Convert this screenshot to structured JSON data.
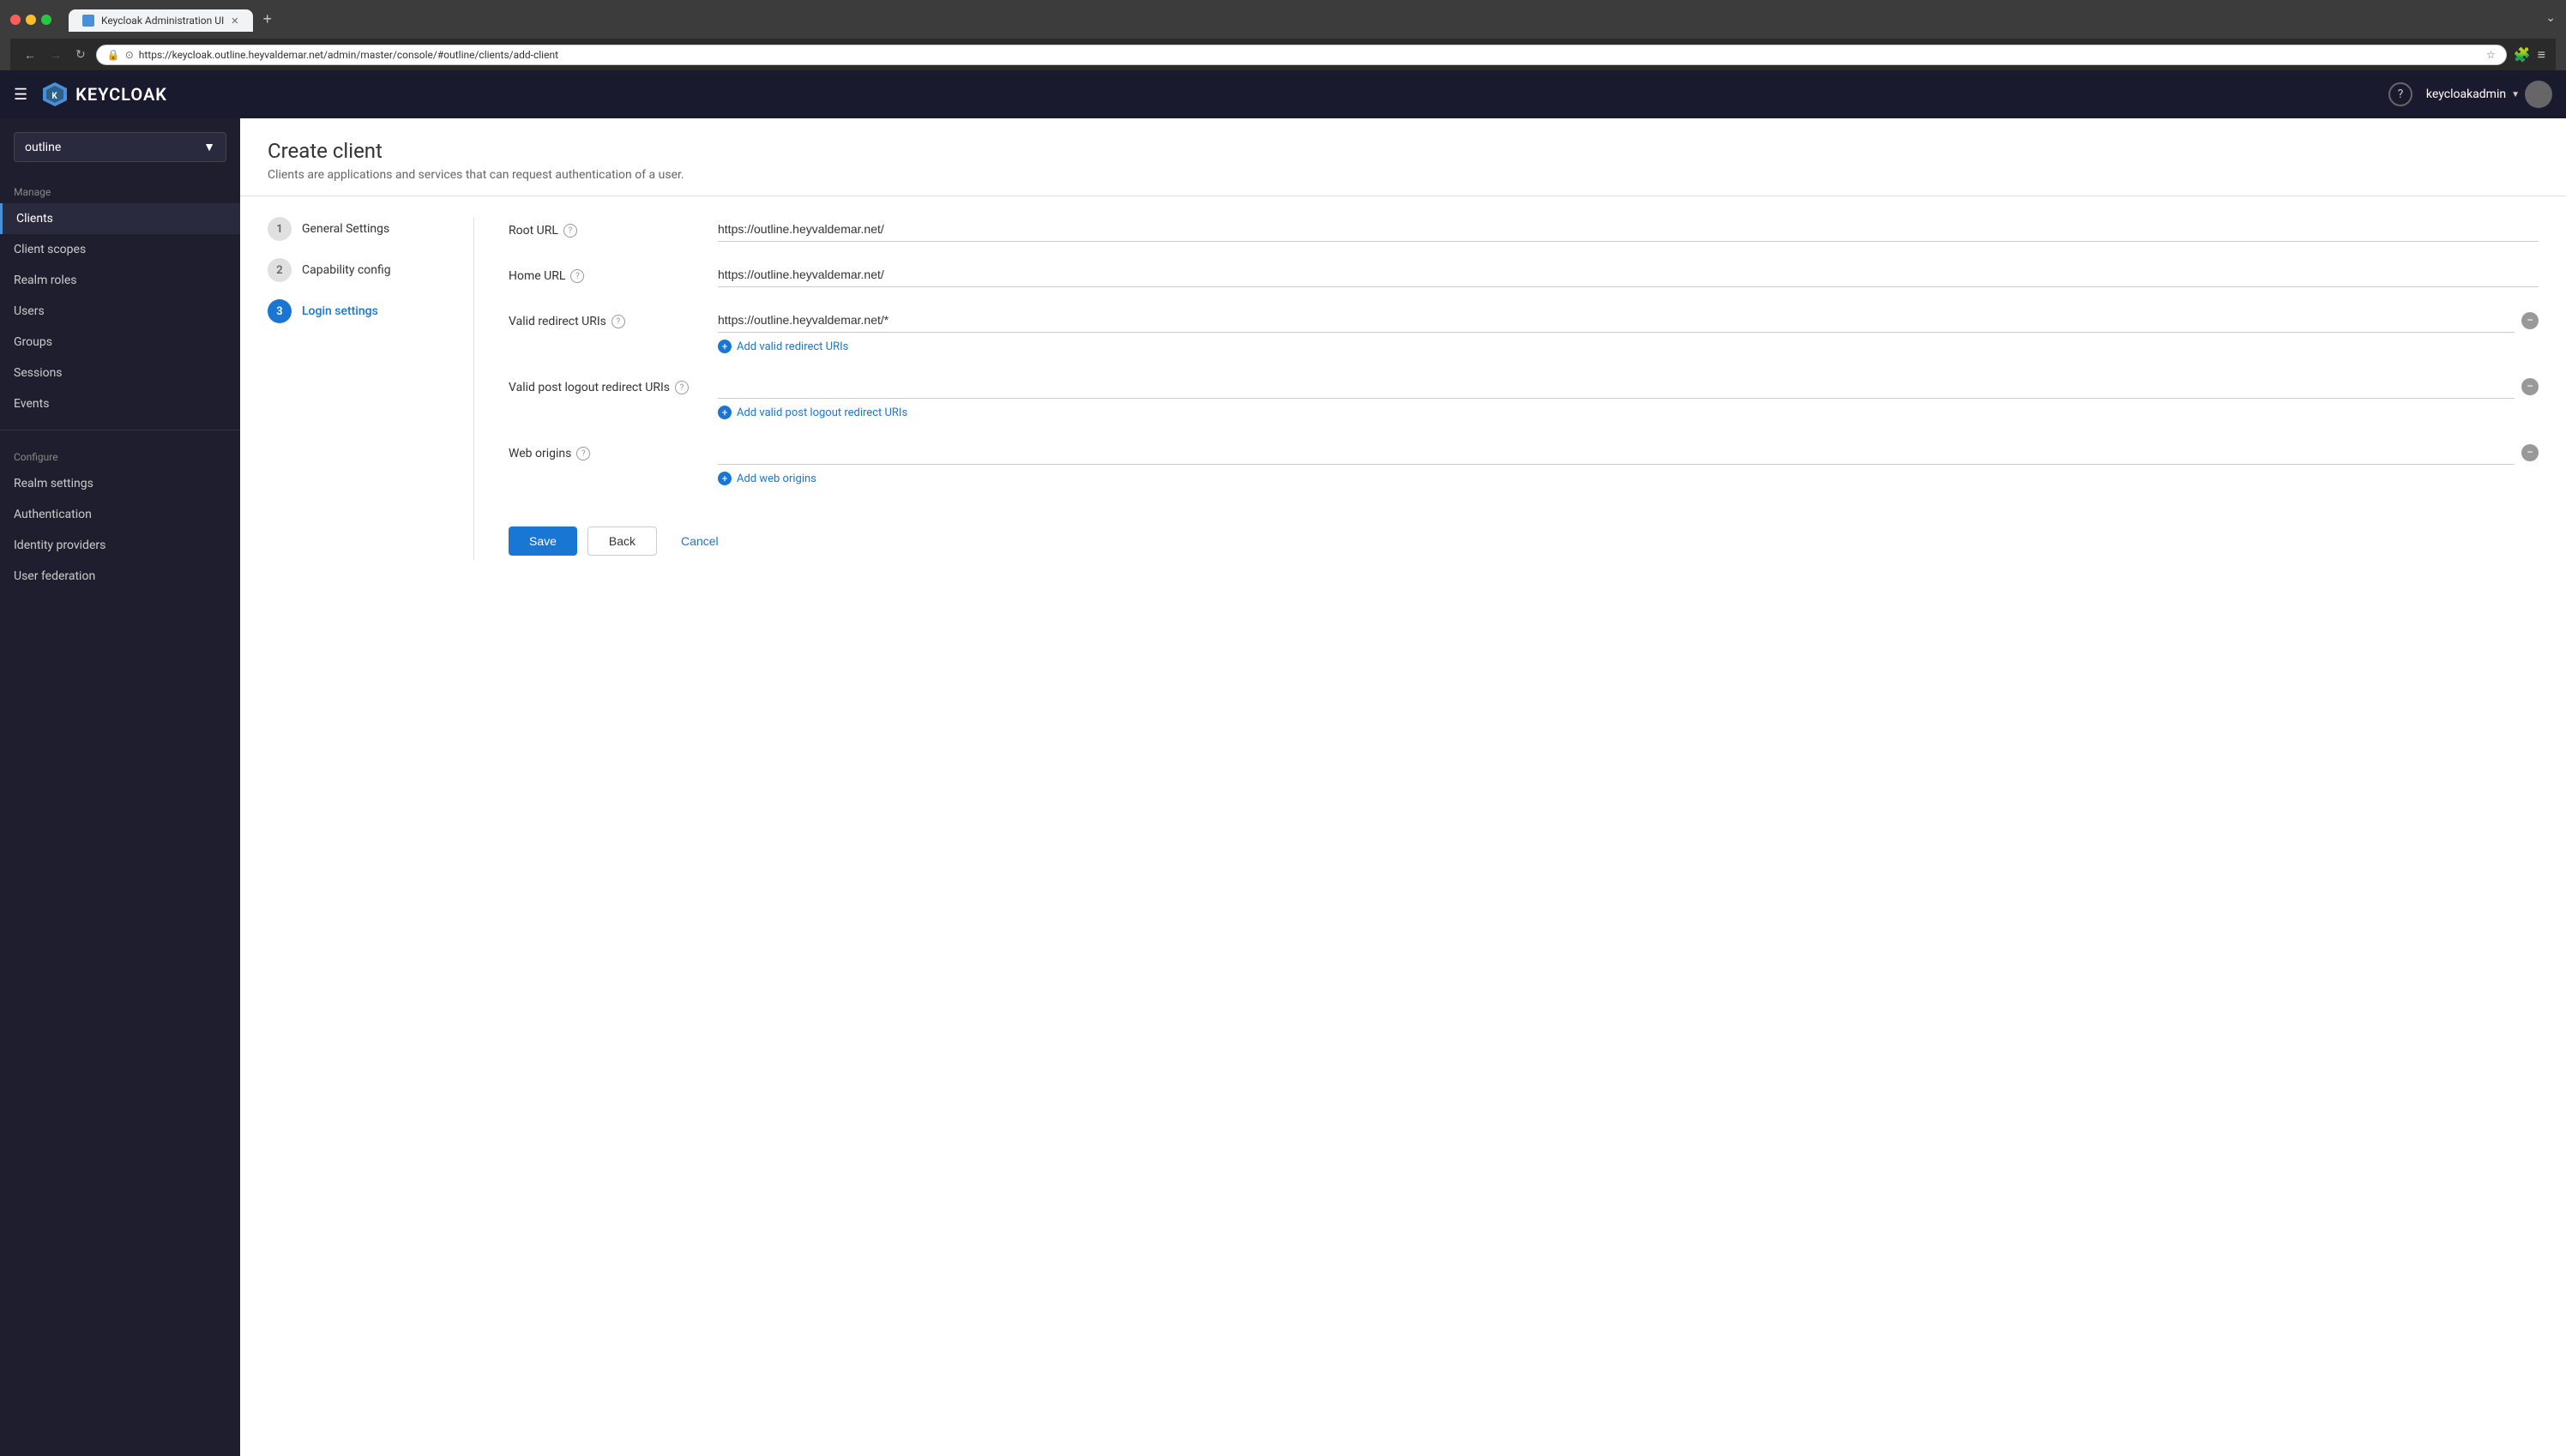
{
  "browser": {
    "url": "https://keycloak.outline.heyvaldemar.net/admin/master/console/#outline/clients/add-client",
    "tab_title": "Keycloak Administration UI",
    "new_tab_label": "+"
  },
  "topnav": {
    "logo_text": "KEYCLOAK",
    "user_name": "keycloakadmin",
    "help_label": "?"
  },
  "sidebar": {
    "realm_name": "outline",
    "manage_header": "Manage",
    "configure_header": "Configure",
    "items_manage": [
      {
        "label": "Clients",
        "active": true
      },
      {
        "label": "Client scopes",
        "active": false
      },
      {
        "label": "Realm roles",
        "active": false
      },
      {
        "label": "Users",
        "active": false
      },
      {
        "label": "Groups",
        "active": false
      },
      {
        "label": "Sessions",
        "active": false
      },
      {
        "label": "Events",
        "active": false
      }
    ],
    "items_configure": [
      {
        "label": "Realm settings",
        "active": false
      },
      {
        "label": "Authentication",
        "active": false
      },
      {
        "label": "Identity providers",
        "active": false
      },
      {
        "label": "User federation",
        "active": false
      }
    ]
  },
  "page": {
    "title": "Create client",
    "subtitle": "Clients are applications and services that can request authentication of a user."
  },
  "wizard": {
    "steps": [
      {
        "number": "1",
        "label": "General Settings",
        "state": "inactive"
      },
      {
        "number": "2",
        "label": "Capability config",
        "state": "inactive"
      },
      {
        "number": "3",
        "label": "Login settings",
        "state": "active"
      }
    ]
  },
  "form": {
    "fields": [
      {
        "id": "root_url",
        "label": "Root URL",
        "has_help": true,
        "value": "https://outline.heyvaldemar.net/",
        "type": "text"
      },
      {
        "id": "home_url",
        "label": "Home URL",
        "has_help": true,
        "value": "https://outline.heyvaldemar.net/",
        "type": "text"
      },
      {
        "id": "valid_redirect_uris",
        "label": "Valid redirect URIs",
        "has_help": true,
        "value": "https://outline.heyvaldemar.net/*",
        "type": "input_with_remove",
        "add_link_text": "Add valid redirect URIs"
      },
      {
        "id": "valid_post_logout",
        "label": "Valid post logout redirect URIs",
        "has_help": true,
        "value": "",
        "type": "input_with_remove",
        "add_link_text": "Add valid post logout redirect URIs"
      },
      {
        "id": "web_origins",
        "label": "Web origins",
        "has_help": true,
        "value": "",
        "type": "input_with_remove",
        "add_link_text": "Add web origins"
      }
    ],
    "actions": {
      "save": "Save",
      "back": "Back",
      "cancel": "Cancel"
    }
  }
}
